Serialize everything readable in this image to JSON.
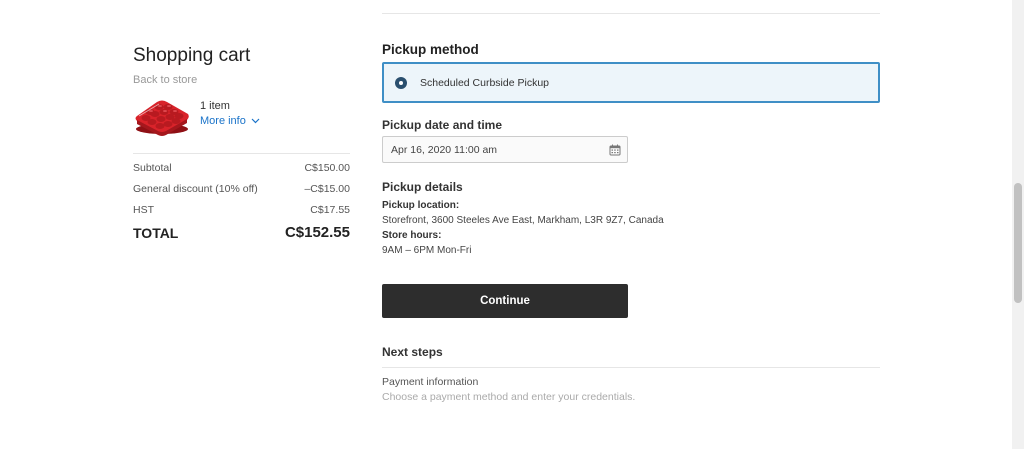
{
  "cart": {
    "title": "Shopping cart",
    "back_link": "Back to store",
    "item_count": "1 item",
    "more_info": "More info",
    "totals": [
      {
        "label": "Subtotal",
        "amount": "C$150.00"
      },
      {
        "label": "General discount (10% off)",
        "amount": "–C$15.00"
      },
      {
        "label": "HST",
        "amount": "C$17.55"
      }
    ],
    "total_label": "TOTAL",
    "total_amount": "C$152.55"
  },
  "pickup": {
    "method_heading": "Pickup method",
    "method_option": "Scheduled Curbside Pickup",
    "method_selected": true,
    "datetime_heading": "Pickup date and time",
    "datetime_value": "Apr 16, 2020 11:00 am",
    "details_heading": "Pickup details",
    "location_label": "Pickup location:",
    "location_value": "Storefront, 3600 Steeles Ave East, Markham, L3R 9Z7, Canada",
    "hours_label": "Store hours:",
    "hours_value": "9AM – 6PM Mon-Fri",
    "continue_label": "Continue"
  },
  "next_steps": {
    "heading": "Next steps",
    "steps": [
      {
        "title": "Payment information",
        "description": "Choose a payment method and enter your credentials."
      }
    ]
  },
  "colors": {
    "accent_blue": "#3f8fc6",
    "selected_bg": "#edf5fa",
    "link_blue": "#1a73c9",
    "button_bg": "#2d2d2d",
    "product_red": "#d9232a"
  },
  "icons": {
    "radio": "radio-selected-icon",
    "calendar": "calendar-icon",
    "chevron": "chevron-down-icon",
    "product": "product-thumbnail"
  }
}
